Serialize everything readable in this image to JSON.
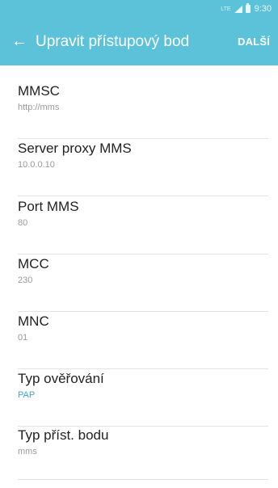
{
  "status_bar": {
    "network": "LTE",
    "time": "9:30"
  },
  "header": {
    "back_icon": "arrow-left-icon",
    "title": "Upravit přístupový bod",
    "next_label": "DALŠÍ"
  },
  "colors": {
    "primary": "#5cc2d9",
    "accent_value": "#39a8d8"
  },
  "settings": [
    {
      "label": "MMSC",
      "value": "http://mms"
    },
    {
      "label": "Server proxy MMS",
      "value": "10.0.0.10"
    },
    {
      "label": "Port MMS",
      "value": "80"
    },
    {
      "label": "MCC",
      "value": "230"
    },
    {
      "label": "MNC",
      "value": "01"
    },
    {
      "label": "Typ ověřování",
      "value": "PAP"
    },
    {
      "label": "Typ příst. bodu",
      "value": "mms"
    }
  ]
}
